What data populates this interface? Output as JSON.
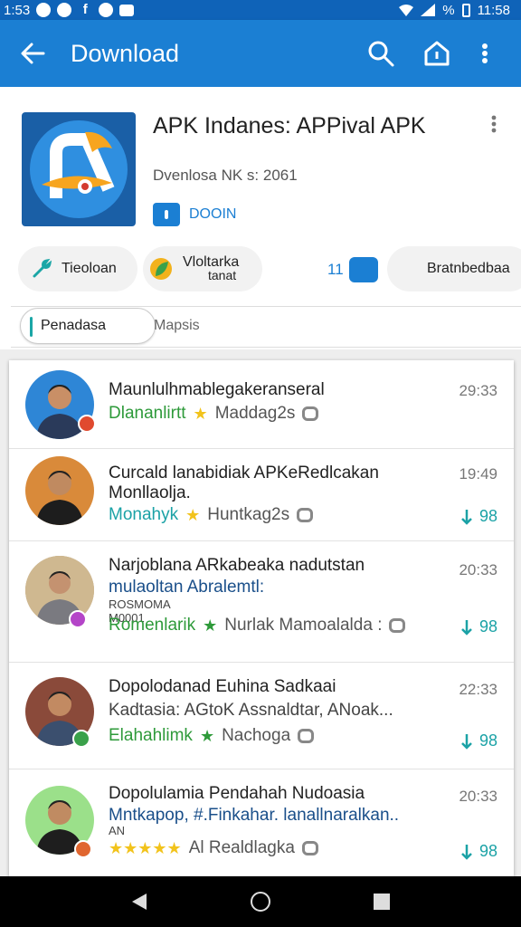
{
  "status": {
    "time_left": "1:53",
    "battery_pct": "%",
    "time_right": "11:58"
  },
  "appbar": {
    "title": "Download"
  },
  "app": {
    "name": "APK Indanes: APPival APK",
    "meta": "Dvenlosa NK s: 2061",
    "badge_label": "DOOIN"
  },
  "chips": {
    "chip1": "Tieoloan",
    "chip2_line1": "Vloltarka",
    "chip2_line2": "tanat",
    "rank": "11",
    "chip4": "Bratnbedbaa"
  },
  "tabs": {
    "active": "Penadasa",
    "second": "Mapsis"
  },
  "reviews": [
    {
      "title": "Maunlulhmablegakeranseral",
      "subtitle": "",
      "tag": "",
      "developer": "Dlananlirtt",
      "reviewer": "Maddag2s",
      "time": "29:33",
      "count": ""
    },
    {
      "title": "Curcald lanabidiak APKeRedlcakan Monllaolja.",
      "subtitle": "",
      "tag": "",
      "developer": "Monahyk",
      "reviewer": "Huntkag2s",
      "time": "19:49",
      "count": "98"
    },
    {
      "title": "Narjoblana ARkabeaka nadutstan",
      "subtitle": "mulaoltan Abralemtl:",
      "tag": "ROSMOMA M0001",
      "developer": "Romenlarik",
      "reviewer": "Nurlak Mamoalalda :",
      "time": "20:33",
      "count": "98"
    },
    {
      "title": "Dopolodanad Euhina Sadkaai",
      "subtitle": "Kadtasia: AGtoK Assnaldtar, ANoak...",
      "tag": "",
      "developer": "Elahahlimk",
      "reviewer": "Nachoga",
      "time": "22:33",
      "count": "98"
    },
    {
      "title": "Dopolulamia Pendahah Nudoasia",
      "subtitle": "Mntkapop, #.Finkahar. lanallnaralkan..",
      "tag": "AN",
      "developer": "",
      "reviewer": "Al Realdlagka",
      "time": "20:33",
      "count": "98"
    }
  ],
  "colors": {
    "appbar": "#1b7fd3",
    "statusbar": "#0f63b8",
    "accent": "#1ba2a6",
    "green": "#2e9a3a",
    "star": "#f2c31c"
  }
}
